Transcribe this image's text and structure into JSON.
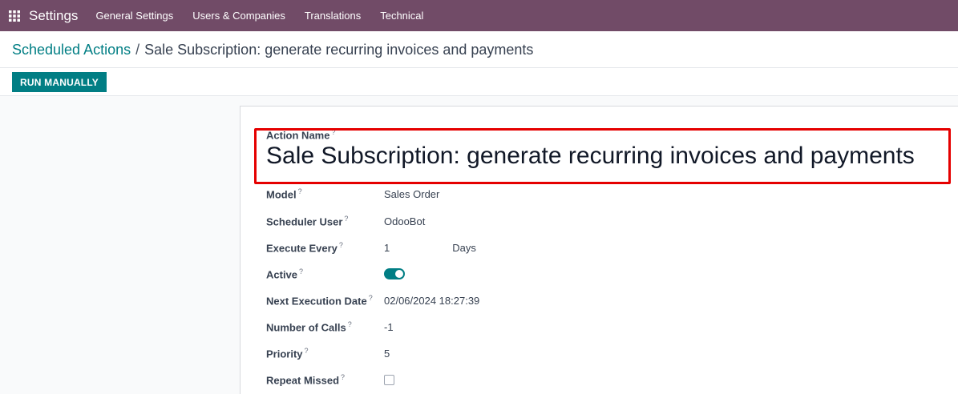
{
  "navbar": {
    "app_name": "Settings",
    "items": [
      "General Settings",
      "Users & Companies",
      "Translations",
      "Technical"
    ]
  },
  "breadcrumb": {
    "parent": "Scheduled Actions",
    "separator": "/",
    "current": "Sale Subscription: generate recurring invoices and payments"
  },
  "toolbar": {
    "run_label": "RUN MANUALLY"
  },
  "form": {
    "action_name_label": "Action Name",
    "action_name_value": "Sale Subscription: generate recurring invoices and payments",
    "help_mark": "?",
    "fields": {
      "model": {
        "label": "Model",
        "value": "Sales Order"
      },
      "scheduler_user": {
        "label": "Scheduler User",
        "value": "OdooBot"
      },
      "execute_every": {
        "label": "Execute Every",
        "value": "1",
        "unit": "Days"
      },
      "active": {
        "label": "Active",
        "value": true
      },
      "next_execution": {
        "label": "Next Execution Date",
        "value": "02/06/2024 18:27:39"
      },
      "number_of_calls": {
        "label": "Number of Calls",
        "value": "-1"
      },
      "priority": {
        "label": "Priority",
        "value": "5"
      },
      "repeat_missed": {
        "label": "Repeat Missed",
        "value": false
      }
    }
  },
  "colors": {
    "navbar": "#714b67",
    "accent": "#017e84",
    "highlight_border": "#e50000"
  },
  "icons": {
    "apps": "grid-icon"
  }
}
